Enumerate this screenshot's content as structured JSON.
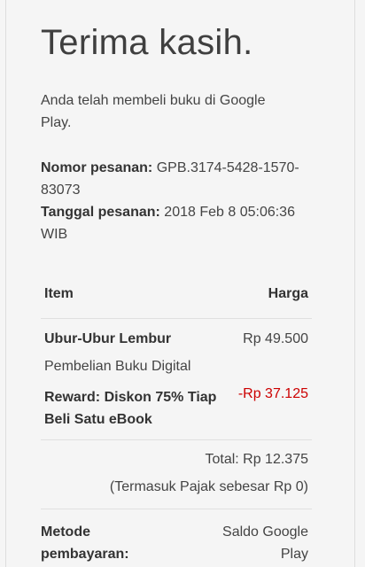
{
  "heading": "Terima kasih.",
  "intro": "Anda telah membeli buku di Google Play.",
  "order": {
    "number_label": "Nomor pesanan:",
    "number_value": "GPB.3174-5428-1570-83073",
    "date_label": "Tanggal pesanan:",
    "date_value": "2018 Feb 8 05:06:36 WIB"
  },
  "table": {
    "col_item": "Item",
    "col_price": "Harga",
    "book_title": "Ubur-Ubur Lembur",
    "book_price": "Rp 49.500",
    "book_type": "Pembelian Buku Digital",
    "reward_label": "Reward: Diskon 75% Tiap Beli Satu eBook",
    "reward_price": "-Rp 37.125",
    "total": "Total: Rp 12.375",
    "tax": "(Termasuk Pajak sebesar Rp 0)"
  },
  "payment": {
    "label": "Metode pembayaran:",
    "value": "Saldo Google Play"
  },
  "colors": {
    "background": "#f5f5f5",
    "text": "#3a3a3a",
    "discount": "#cc0000"
  }
}
